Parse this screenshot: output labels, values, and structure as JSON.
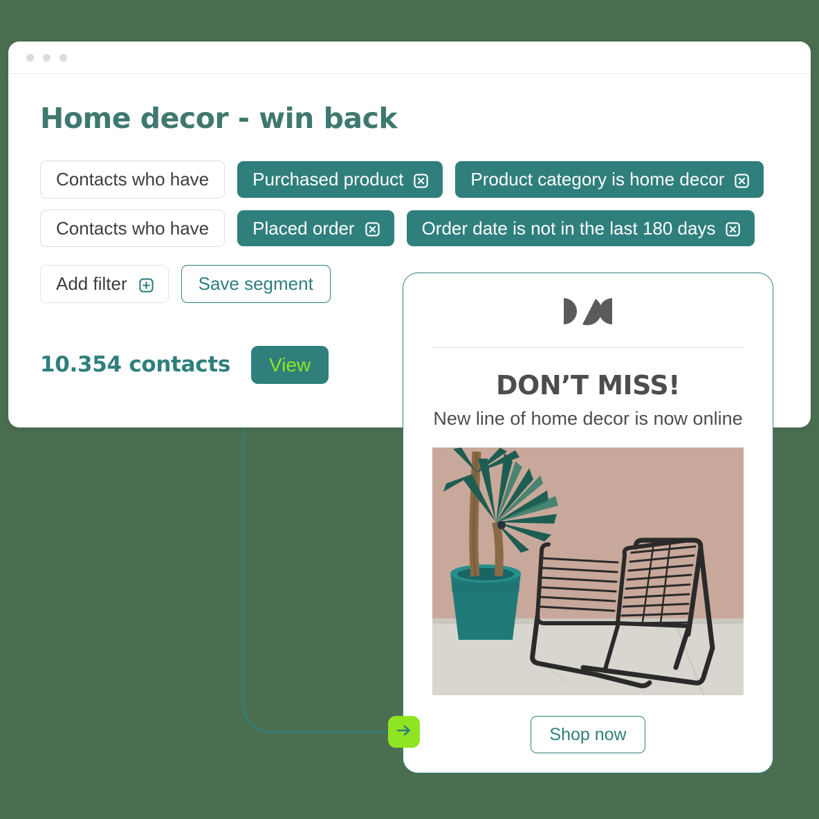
{
  "theme": {
    "background": "#4b6e51",
    "teal": "#2f7f7d",
    "title_teal": "#3e786f",
    "lime": "#8fe522",
    "card_white": "#ffffff",
    "muted_text": "#4d4d4d"
  },
  "browser": {
    "window_dots": [
      "window-dot",
      "window-dot",
      "window-dot"
    ],
    "title": "Home decor - win back",
    "filter_rows": [
      {
        "select_label": "Contacts who have",
        "pills": [
          {
            "label": "Purchased product",
            "remove_icon": "close-icon"
          },
          {
            "label": "Product category is home decor",
            "remove_icon": "close-icon"
          }
        ]
      },
      {
        "select_label": "Contacts who have",
        "pills": [
          {
            "label": "Placed order",
            "remove_icon": "close-icon"
          },
          {
            "label": "Order date is not in the last 180 days",
            "remove_icon": "close-icon"
          }
        ]
      }
    ],
    "actions": {
      "add_filter_label": "Add filter",
      "add_filter_icon": "plus-square-icon",
      "save_segment_label": "Save segment"
    },
    "summary": {
      "count_label": "10.354 contacts",
      "view_label": "View"
    }
  },
  "email_preview": {
    "logo_icon": "brand-logo-icon",
    "heading": "DON’T MISS!",
    "subheading": "New line of home decor is now online",
    "image": {
      "alt": "black wire chair next to a yucca plant in a teal pot",
      "wall_color": "#cbab9d",
      "floor_color": "#d9d6cf",
      "pot_color": "#1f7a78",
      "plant_color": "#1e5d52",
      "chair_color": "#2a2a2a"
    },
    "cta_label": "Shop now"
  },
  "connector": {
    "arrow_icon": "arrow-right-icon",
    "line_color": "#2f7f7d",
    "badge_color": "#8fe522"
  }
}
